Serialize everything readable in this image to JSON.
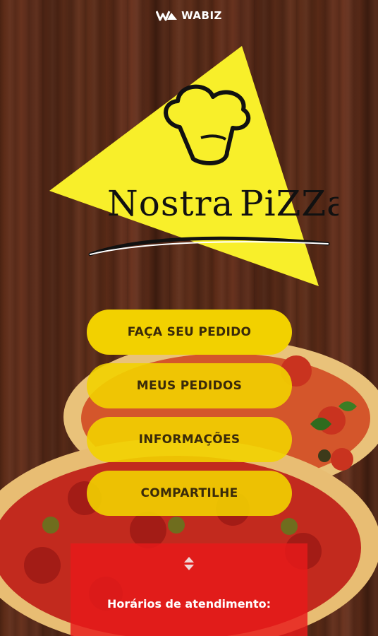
{
  "brand": {
    "name": "WABIZ"
  },
  "logo": {
    "line1": "Nostra",
    "line2": "PiZZa"
  },
  "menu": [
    {
      "label": "FAÇA SEU PEDIDO"
    },
    {
      "label": "MEUS PEDIDOS"
    },
    {
      "label": "INFORMAÇÕES"
    },
    {
      "label": "COMPARTILHE"
    }
  ],
  "hours": {
    "title": "Horários de atendimento:"
  },
  "colors": {
    "accent": "#f2d100",
    "panel": "#e81a1a",
    "wood": "#5b2b18"
  }
}
